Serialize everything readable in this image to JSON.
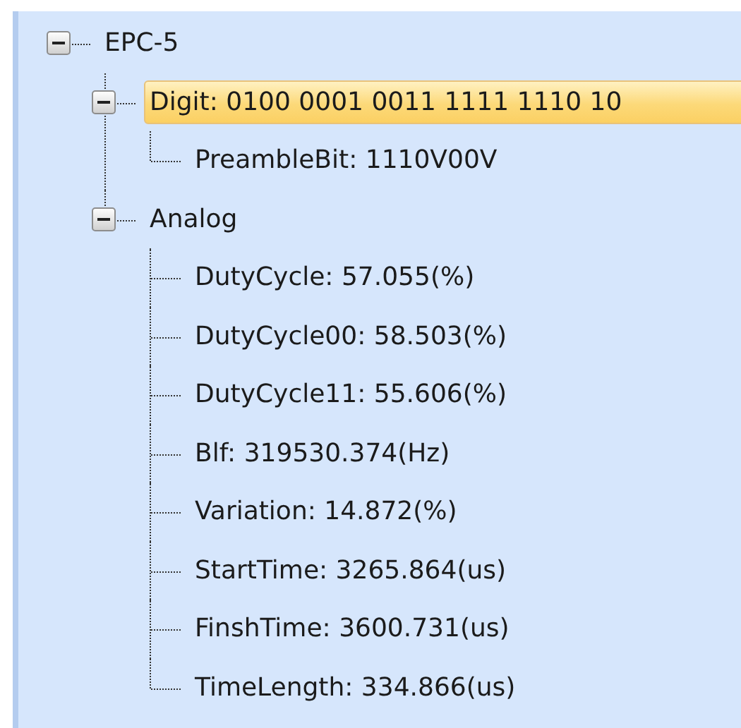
{
  "tree": [
    {
      "label": "EPC-5",
      "expanded": true,
      "selected": false,
      "children": [
        {
          "label": "Digit: 0100 0001 0011 1111 1110 10",
          "expanded": true,
          "selected": true,
          "children": [
            {
              "label": "PreambleBit: 1110V00V",
              "selected": false
            }
          ]
        },
        {
          "label": "Analog",
          "expanded": true,
          "selected": false,
          "children": [
            {
              "label": "DutyCycle: 57.055(%)",
              "selected": false
            },
            {
              "label": "DutyCycle00: 58.503(%)",
              "selected": false
            },
            {
              "label": "DutyCycle11: 55.606(%)",
              "selected": false
            },
            {
              "label": "Blf: 319530.374(Hz)",
              "selected": false
            },
            {
              "label": "Variation: 14.872(%)",
              "selected": false
            },
            {
              "label": "StartTime: 3265.864(us)",
              "selected": false
            },
            {
              "label": "FinshTime: 3600.731(us)",
              "selected": false
            },
            {
              "label": "TimeLength: 334.866(us)",
              "selected": false
            }
          ]
        }
      ]
    }
  ]
}
